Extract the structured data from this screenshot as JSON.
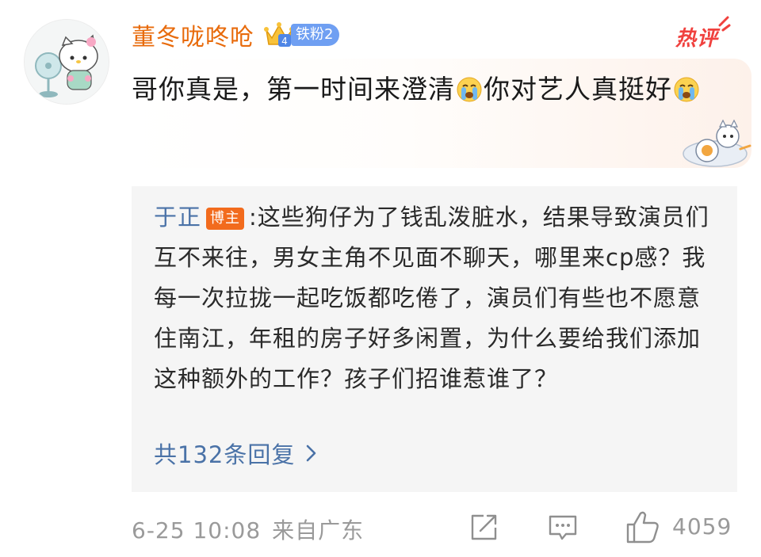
{
  "comment": {
    "username": "董冬咙咚呛",
    "fan_level": "4",
    "fan_badge": "铁粉2",
    "hot_tag": "热评",
    "text_part1": "哥你真是，第一时间来澄清",
    "text_part2": "你对艺人真挺好",
    "emoji": "cry-emoji"
  },
  "reply": {
    "author": "于正",
    "author_badge": "博主",
    "separator": ":",
    "text": "这些狗仔为了钱乱泼脏水，结果导致演员们互不来往，男女主角不见面不聊天，哪里来cp感？我每一次拉拢一起吃饭都吃倦了，演员们有些也不愿意住南江，年租的房子好多闲置，为什么要给我们添加这种额外的工作？孩子们招谁惹谁了？",
    "count_label": "共132条回复"
  },
  "footer": {
    "date": "6-25 10:08",
    "location": "来自广东",
    "like_count": "4059"
  },
  "colors": {
    "username": "#e86b0c",
    "link": "#4a72a7",
    "hot": "#f0413e",
    "fan_badge": "#6f9ff2",
    "owner_badge": "#f26b1d",
    "meta": "#9a9a9a"
  }
}
